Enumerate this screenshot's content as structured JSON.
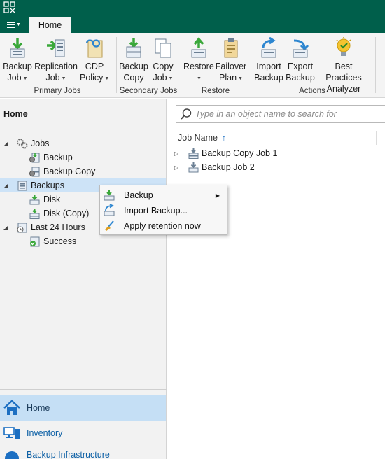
{
  "colors": {
    "brand": "#005f4b",
    "accent_green": "#3aa83a",
    "select_blue": "#cde3f7",
    "link_blue": "#0b5fa5"
  },
  "tabs": [
    {
      "label": "Home",
      "active": true
    }
  ],
  "ribbon": {
    "groups": [
      {
        "label": "Primary Jobs",
        "buttons": [
          {
            "line1": "Backup",
            "line2": "Job",
            "icon": "backup-job-icon",
            "dropdown": true
          },
          {
            "line1": "Replication",
            "line2": "Job",
            "icon": "replication-job-icon",
            "dropdown": true
          },
          {
            "line1": "CDP",
            "line2": "Policy",
            "icon": "cdp-policy-icon",
            "dropdown": true
          }
        ]
      },
      {
        "label": "Secondary Jobs",
        "buttons": [
          {
            "line1": "Backup",
            "line2": "Copy",
            "icon": "backup-copy-icon",
            "dropdown": false
          },
          {
            "line1": "Copy",
            "line2": "Job",
            "icon": "copy-job-icon",
            "dropdown": true
          }
        ]
      },
      {
        "label": "Restore",
        "buttons": [
          {
            "line1": "Restore",
            "line2": "",
            "icon": "restore-icon",
            "dropdown": true
          },
          {
            "line1": "Failover",
            "line2": "Plan",
            "icon": "failover-plan-icon",
            "dropdown": true
          }
        ]
      },
      {
        "label": "Actions",
        "buttons": [
          {
            "line1": "Import",
            "line2": "Backup",
            "icon": "import-backup-icon",
            "dropdown": false
          },
          {
            "line1": "Export",
            "line2": "Backup",
            "icon": "export-backup-icon",
            "dropdown": false
          },
          {
            "line1": "Best Practices",
            "line2": "Analyzer",
            "icon": "best-practices-icon",
            "dropdown": false
          }
        ]
      }
    ]
  },
  "left_pane": {
    "title": "Home",
    "tree": [
      {
        "label": "Jobs",
        "expandable": true,
        "icon": "jobs-gear-icon"
      },
      {
        "label": "Backup",
        "expandable": false,
        "icon": "backup-job-gear-icon"
      },
      {
        "label": "Backup Copy",
        "expandable": false,
        "icon": "backup-copy-gear-icon"
      },
      {
        "label": "Backups",
        "expandable": true,
        "icon": "backups-icon",
        "selected": true
      },
      {
        "label": "Disk",
        "expandable": false,
        "icon": "disk-icon"
      },
      {
        "label": "Disk (Copy)",
        "expandable": false,
        "icon": "disk-copy-icon"
      },
      {
        "label": "Last 24 Hours",
        "expandable": true,
        "icon": "last-24-hours-icon"
      },
      {
        "label": "Success",
        "expandable": false,
        "icon": "success-icon"
      }
    ],
    "nav": [
      {
        "label": "Home",
        "icon": "home-icon",
        "active": true
      },
      {
        "label": "Inventory",
        "icon": "inventory-icon",
        "active": false
      },
      {
        "label": "Backup Infrastructure",
        "icon": "backup-infrastructure-icon",
        "active": false
      }
    ]
  },
  "right_pane": {
    "search_placeholder": "Type in an object name to search for",
    "column_header": "Job Name",
    "sort_indicator": "↑",
    "rows": [
      {
        "label": "Backup Copy Job 1",
        "icon": "backup-copy-job-icon"
      },
      {
        "label": "Backup Job 2",
        "icon": "backup-job-icon"
      }
    ]
  },
  "context_menu": {
    "items": [
      {
        "label": "Backup",
        "icon": "backup-menu-icon",
        "submenu": true
      },
      {
        "label": "Import Backup...",
        "icon": "import-backup-menu-icon",
        "submenu": false
      },
      {
        "label": "Apply retention now",
        "icon": "broom-icon",
        "submenu": false
      }
    ]
  }
}
